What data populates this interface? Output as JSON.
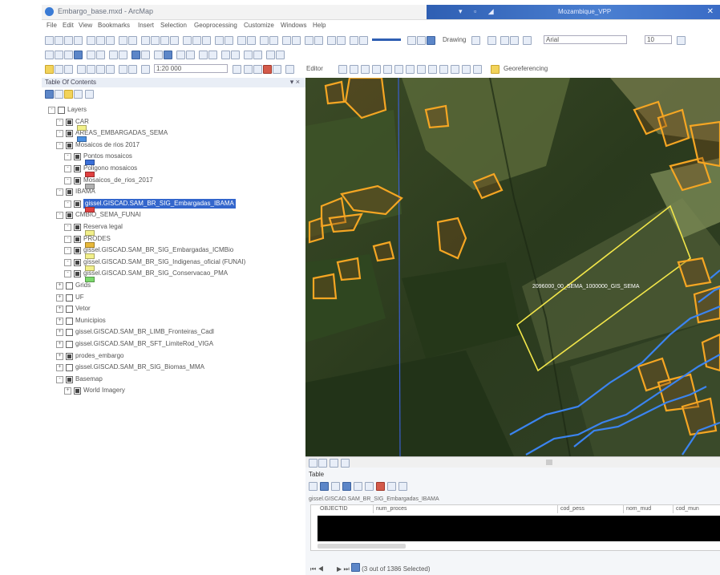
{
  "window": {
    "title": "Embargo_base.mxd - ArcMap",
    "right_title": "Mozambique_VPP"
  },
  "menu": [
    "File",
    "Edit",
    "View",
    "Bookmarks",
    "Insert",
    "Selection",
    "Geoprocessing",
    "Customize",
    "Windows",
    "Help"
  ],
  "toolbar": {
    "drawing_label": "Drawing",
    "font_combo": "Arial",
    "size_combo": "10",
    "scale_combo": "1:20 000",
    "editor_label": "Editor",
    "georef_label": "Georeferencing"
  },
  "toc": {
    "title": "Table Of Contents",
    "rows": [
      {
        "label": "Layers",
        "indent": 0,
        "check": false,
        "expand": "-"
      },
      {
        "label": "CAR",
        "indent": 1,
        "check": true,
        "expand": "-",
        "swatch": "#f2f08a"
      },
      {
        "label": "AREAS_EMBARGADAS_SEMA",
        "indent": 1,
        "check": true,
        "expand": "-",
        "swatch": "#4a90e2"
      },
      {
        "label": "Mosaicos de rios 2017",
        "indent": 1,
        "check": true,
        "expand": "-"
      },
      {
        "label": "Pontos mosaicos",
        "indent": 2,
        "check": true,
        "expand": "-",
        "swatch": "#3a6fd8"
      },
      {
        "label": "Poligono mosaicos",
        "indent": 2,
        "check": true,
        "expand": "-",
        "swatch": "#e04040"
      },
      {
        "label": "Mosaicos_de_rios_2017",
        "indent": 2,
        "check": true,
        "expand": "-",
        "swatch": "#b0b0b0"
      },
      {
        "label": "IBAMA",
        "indent": 1,
        "check": true,
        "expand": "-"
      },
      {
        "label": "gissel.GISCAD.SAM_BR_SIG_Embargadas_IBAMA",
        "indent": 2,
        "check": true,
        "expand": "-",
        "selected": true,
        "swatch": "#e04040"
      },
      {
        "label": "CMBIO_SEMA_FUNAI",
        "indent": 1,
        "check": true,
        "expand": "-"
      },
      {
        "label": "Reserva legal",
        "indent": 2,
        "check": true,
        "expand": "-",
        "swatch": "#f2f08a"
      },
      {
        "label": "PRODES",
        "indent": 2,
        "check": true,
        "expand": "-",
        "swatch": "#e8b83a"
      },
      {
        "label": "gissel.GISCAD.SAM_BR_SIG_Embargadas_ICMBio",
        "indent": 2,
        "check": true,
        "expand": "-",
        "swatch": "#f2f08a"
      },
      {
        "label": "gissel.GISCAD.SAM_BR_SIG_Indigenas_oficial (FUNAI)",
        "indent": 2,
        "check": true,
        "expand": "-",
        "swatch": "#f2f08a"
      },
      {
        "label": "gissel.GISCAD.SAM_BR_SIG_Conservacao_PMA",
        "indent": 2,
        "check": true,
        "expand": "-",
        "swatch": "#7bd86a"
      },
      {
        "label": "Grids",
        "indent": 1,
        "check": false,
        "expand": "+"
      },
      {
        "label": "UF",
        "indent": 1,
        "check": false,
        "expand": "+"
      },
      {
        "label": "Vetor",
        "indent": 1,
        "check": false,
        "expand": "+"
      },
      {
        "label": "Municipios",
        "indent": 1,
        "check": false,
        "expand": "+"
      },
      {
        "label": "gissel.GISCAD.SAM_BR_LIMB_Fronteiras_Cadl",
        "indent": 1,
        "check": false,
        "expand": "+"
      },
      {
        "label": "gissel.GISCAD.SAM_BR_SFT_LimiteRod_VIGA",
        "indent": 1,
        "check": false,
        "expand": "+"
      },
      {
        "label": "prodes_embargo",
        "indent": 1,
        "check": true,
        "expand": "+"
      },
      {
        "label": "gissel.GISCAD.SAM_BR_SIG_Biomas_MMA",
        "indent": 1,
        "check": false,
        "expand": "+"
      },
      {
        "label": "Basemap",
        "indent": 1,
        "check": true,
        "expand": "-"
      },
      {
        "label": "World Imagery",
        "indent": 2,
        "check": true,
        "expand": "+"
      }
    ]
  },
  "map": {
    "annotation": "2096000_00_SEMA_1000000_GIS_SEMA"
  },
  "table": {
    "title": "Table",
    "layer_name": "gissel.GISCAD.SAM_BR_SIG_Embargadas_IBAMA",
    "columns": [
      "OBJECTID",
      "num_proces",
      "cod_pess",
      "nom_mud",
      "cod_mun"
    ],
    "navigation": "(3 out of 1386 Selected)"
  }
}
